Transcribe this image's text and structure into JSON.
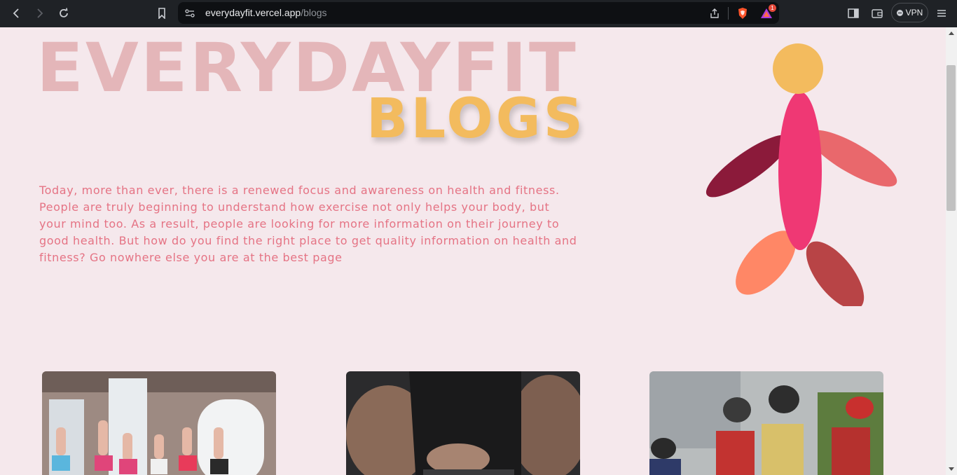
{
  "browser": {
    "url_host": "everydayfit.vercel.app",
    "url_path": "/blogs",
    "vpn_label": "VPN",
    "notification_count": "1"
  },
  "hero": {
    "title": "EVERYDAYFIT",
    "subtitle": "BLOGS",
    "intro": "Today, more than ever, there is a renewed focus and awareness on health and fitness. People are truly beginning to understand how exercise not only helps your body, but your mind too. As a result, people are looking for more information on their journey to good health. But how do you find the right place to get quality information on health and fitness? Go nowhere else you are at the best page"
  },
  "cards": [
    {
      "image": "group-dumbbell-workout-photo"
    },
    {
      "image": "weightlifting-belt-photo"
    },
    {
      "image": "cycling-race-photo"
    }
  ],
  "colors": {
    "page_bg": "#f5e8ec",
    "title": "#e4b6b9",
    "subtitle": "#f3bb5e",
    "intro_text": "#e57384",
    "figure_head": "#f3bb5e",
    "figure_body": "#ef3874",
    "figure_left_arm": "#8b1a3a",
    "figure_right_arm": "#e9686c",
    "figure_left_leg": "#ff8766",
    "figure_right_leg": "#b84446"
  }
}
